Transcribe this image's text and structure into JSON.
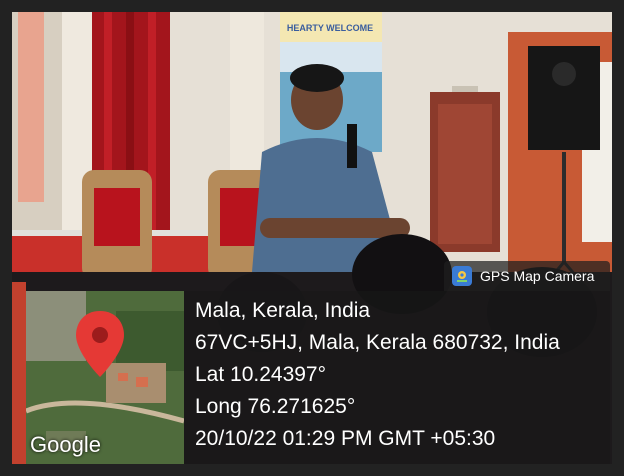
{
  "banner_text": "HEARTY WELCOME",
  "badge": {
    "icon": "gps-map-camera-app-icon",
    "label": "GPS Map Camera"
  },
  "map": {
    "icon": "location-pin-icon",
    "brand": "Google"
  },
  "location": {
    "place": "Mala, Kerala, India",
    "address": "67VC+5HJ, Mala, Kerala 680732, India",
    "lat": "Lat 10.24397°",
    "long": "Long 76.271625°",
    "datetime": "20/10/22 01:29 PM GMT +05:30"
  },
  "colors": {
    "pin": "#e53935",
    "badge_icon": "#3a7bd5",
    "overlay": "#191919"
  }
}
